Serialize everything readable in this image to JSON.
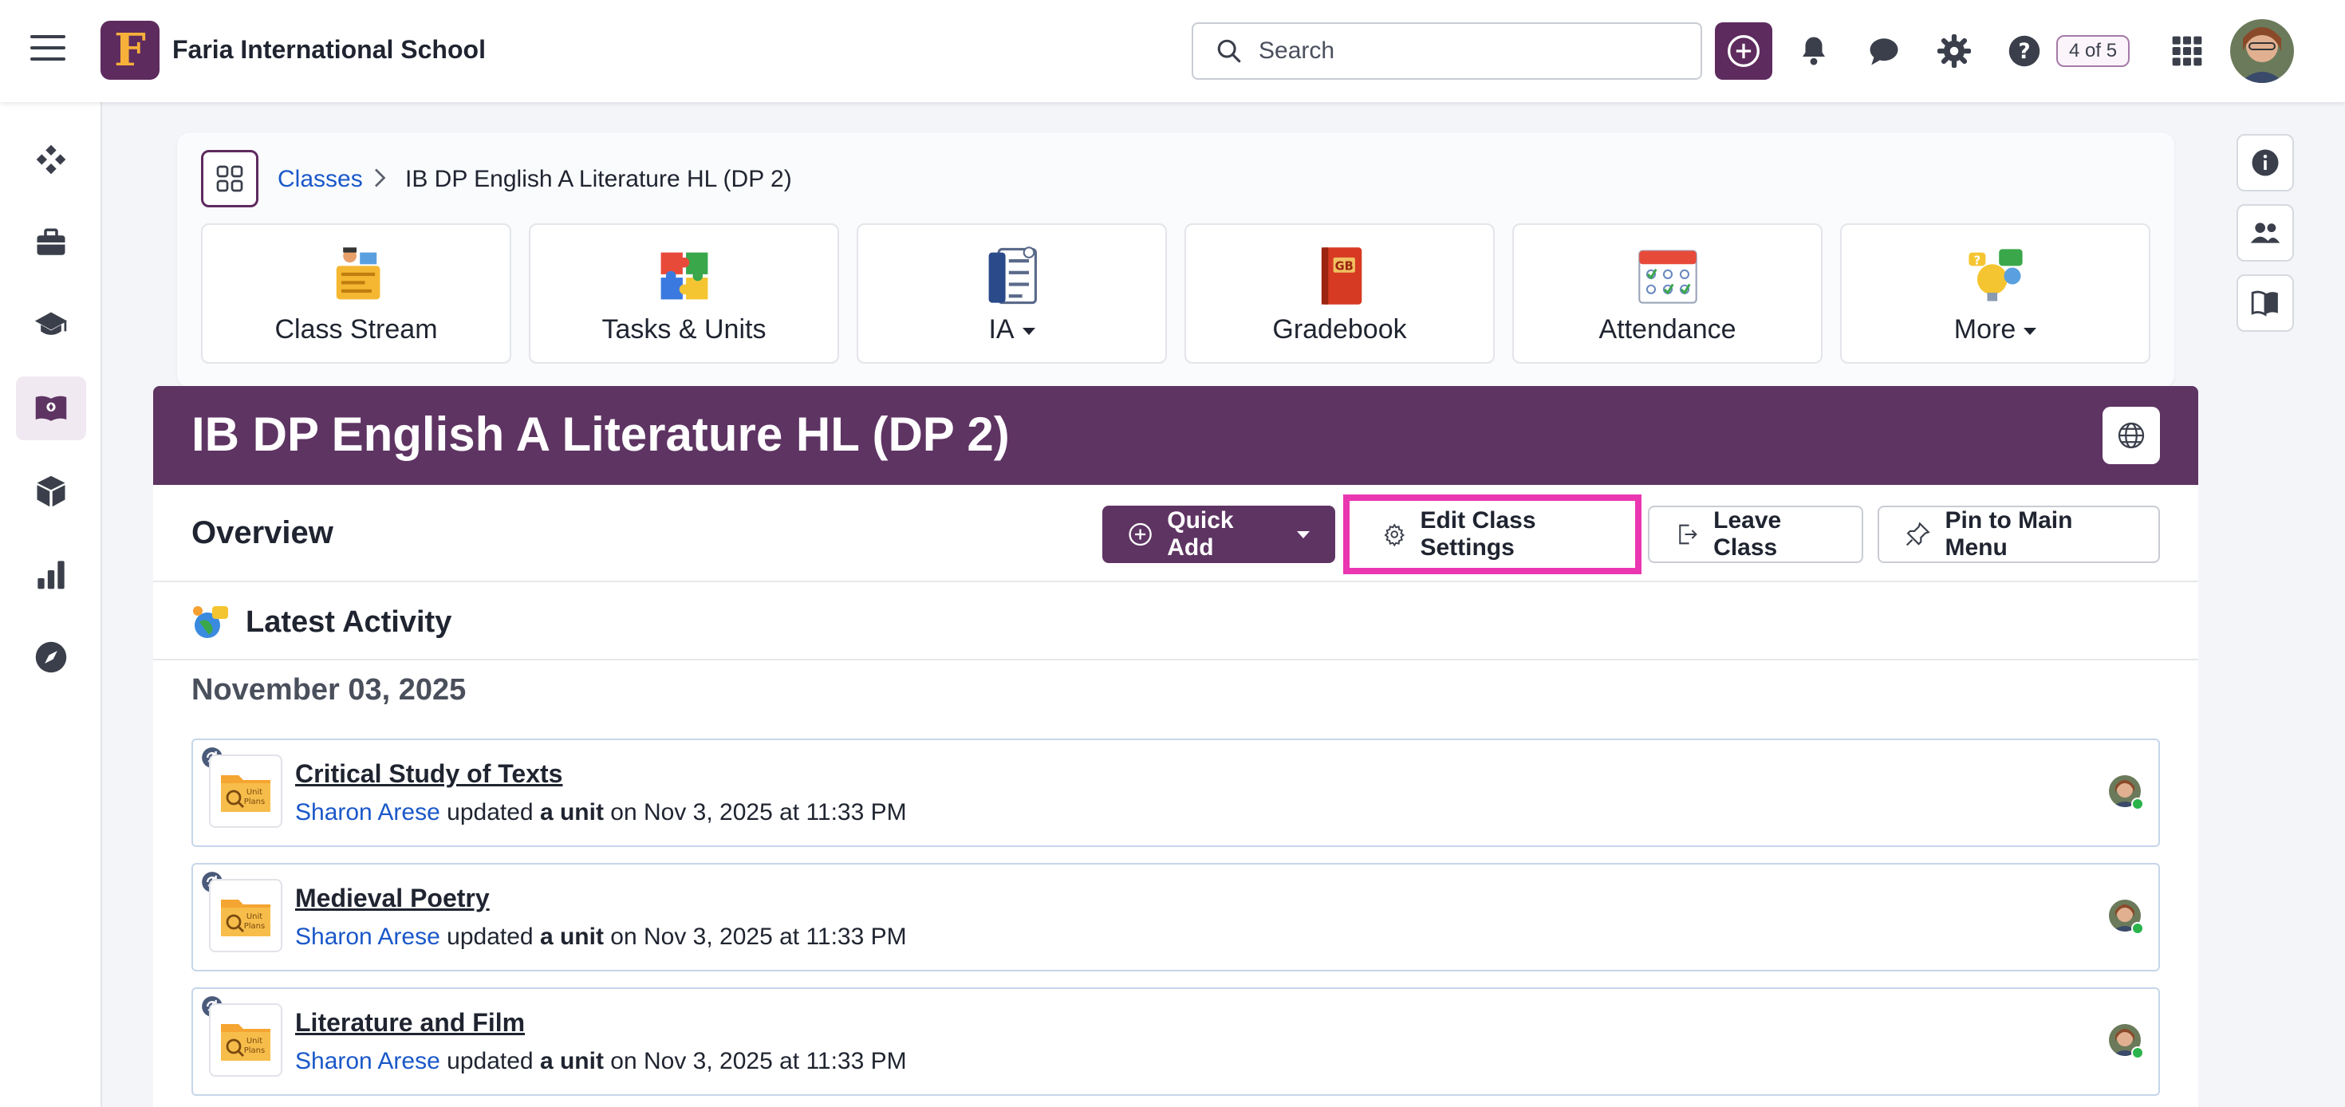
{
  "header": {
    "school_name": "Faria International School",
    "logo_letter": "F",
    "search_placeholder": "Search",
    "help_badge": "4 of 5"
  },
  "breadcrumb": {
    "parent": "Classes",
    "current": "IB DP English A Literature HL (DP 2)"
  },
  "tiles": [
    {
      "label": "Class Stream"
    },
    {
      "label": "Tasks & Units"
    },
    {
      "label": "IA"
    },
    {
      "label": "Gradebook"
    },
    {
      "label": "Attendance"
    },
    {
      "label": "More"
    }
  ],
  "class_header": {
    "title": "IB DP English A Literature HL (DP 2)"
  },
  "overview": {
    "title": "Overview",
    "quick_add": "Quick Add",
    "edit_settings": "Edit Class Settings",
    "leave_class": "Leave Class",
    "pin": "Pin to Main Menu"
  },
  "activity_section": {
    "title": "Latest Activity",
    "date": "November 03, 2025",
    "items": [
      {
        "title": "Critical Study of Texts",
        "who": "Sharon Arese",
        "verb": "updated",
        "object": "a unit",
        "when": "on Nov 3, 2025 at 11:33 PM"
      },
      {
        "title": "Medieval Poetry",
        "who": "Sharon Arese",
        "verb": "updated",
        "object": "a unit",
        "when": "on Nov 3, 2025 at 11:33 PM"
      },
      {
        "title": "Literature and Film",
        "who": "Sharon Arese",
        "verb": "updated",
        "object": "a unit",
        "when": "on Nov 3, 2025 at 11:33 PM"
      }
    ]
  },
  "colors": {
    "brand": "#5e3463",
    "link": "#1a58c9",
    "highlight": "#ea36b0",
    "online": "#2bb34b"
  }
}
